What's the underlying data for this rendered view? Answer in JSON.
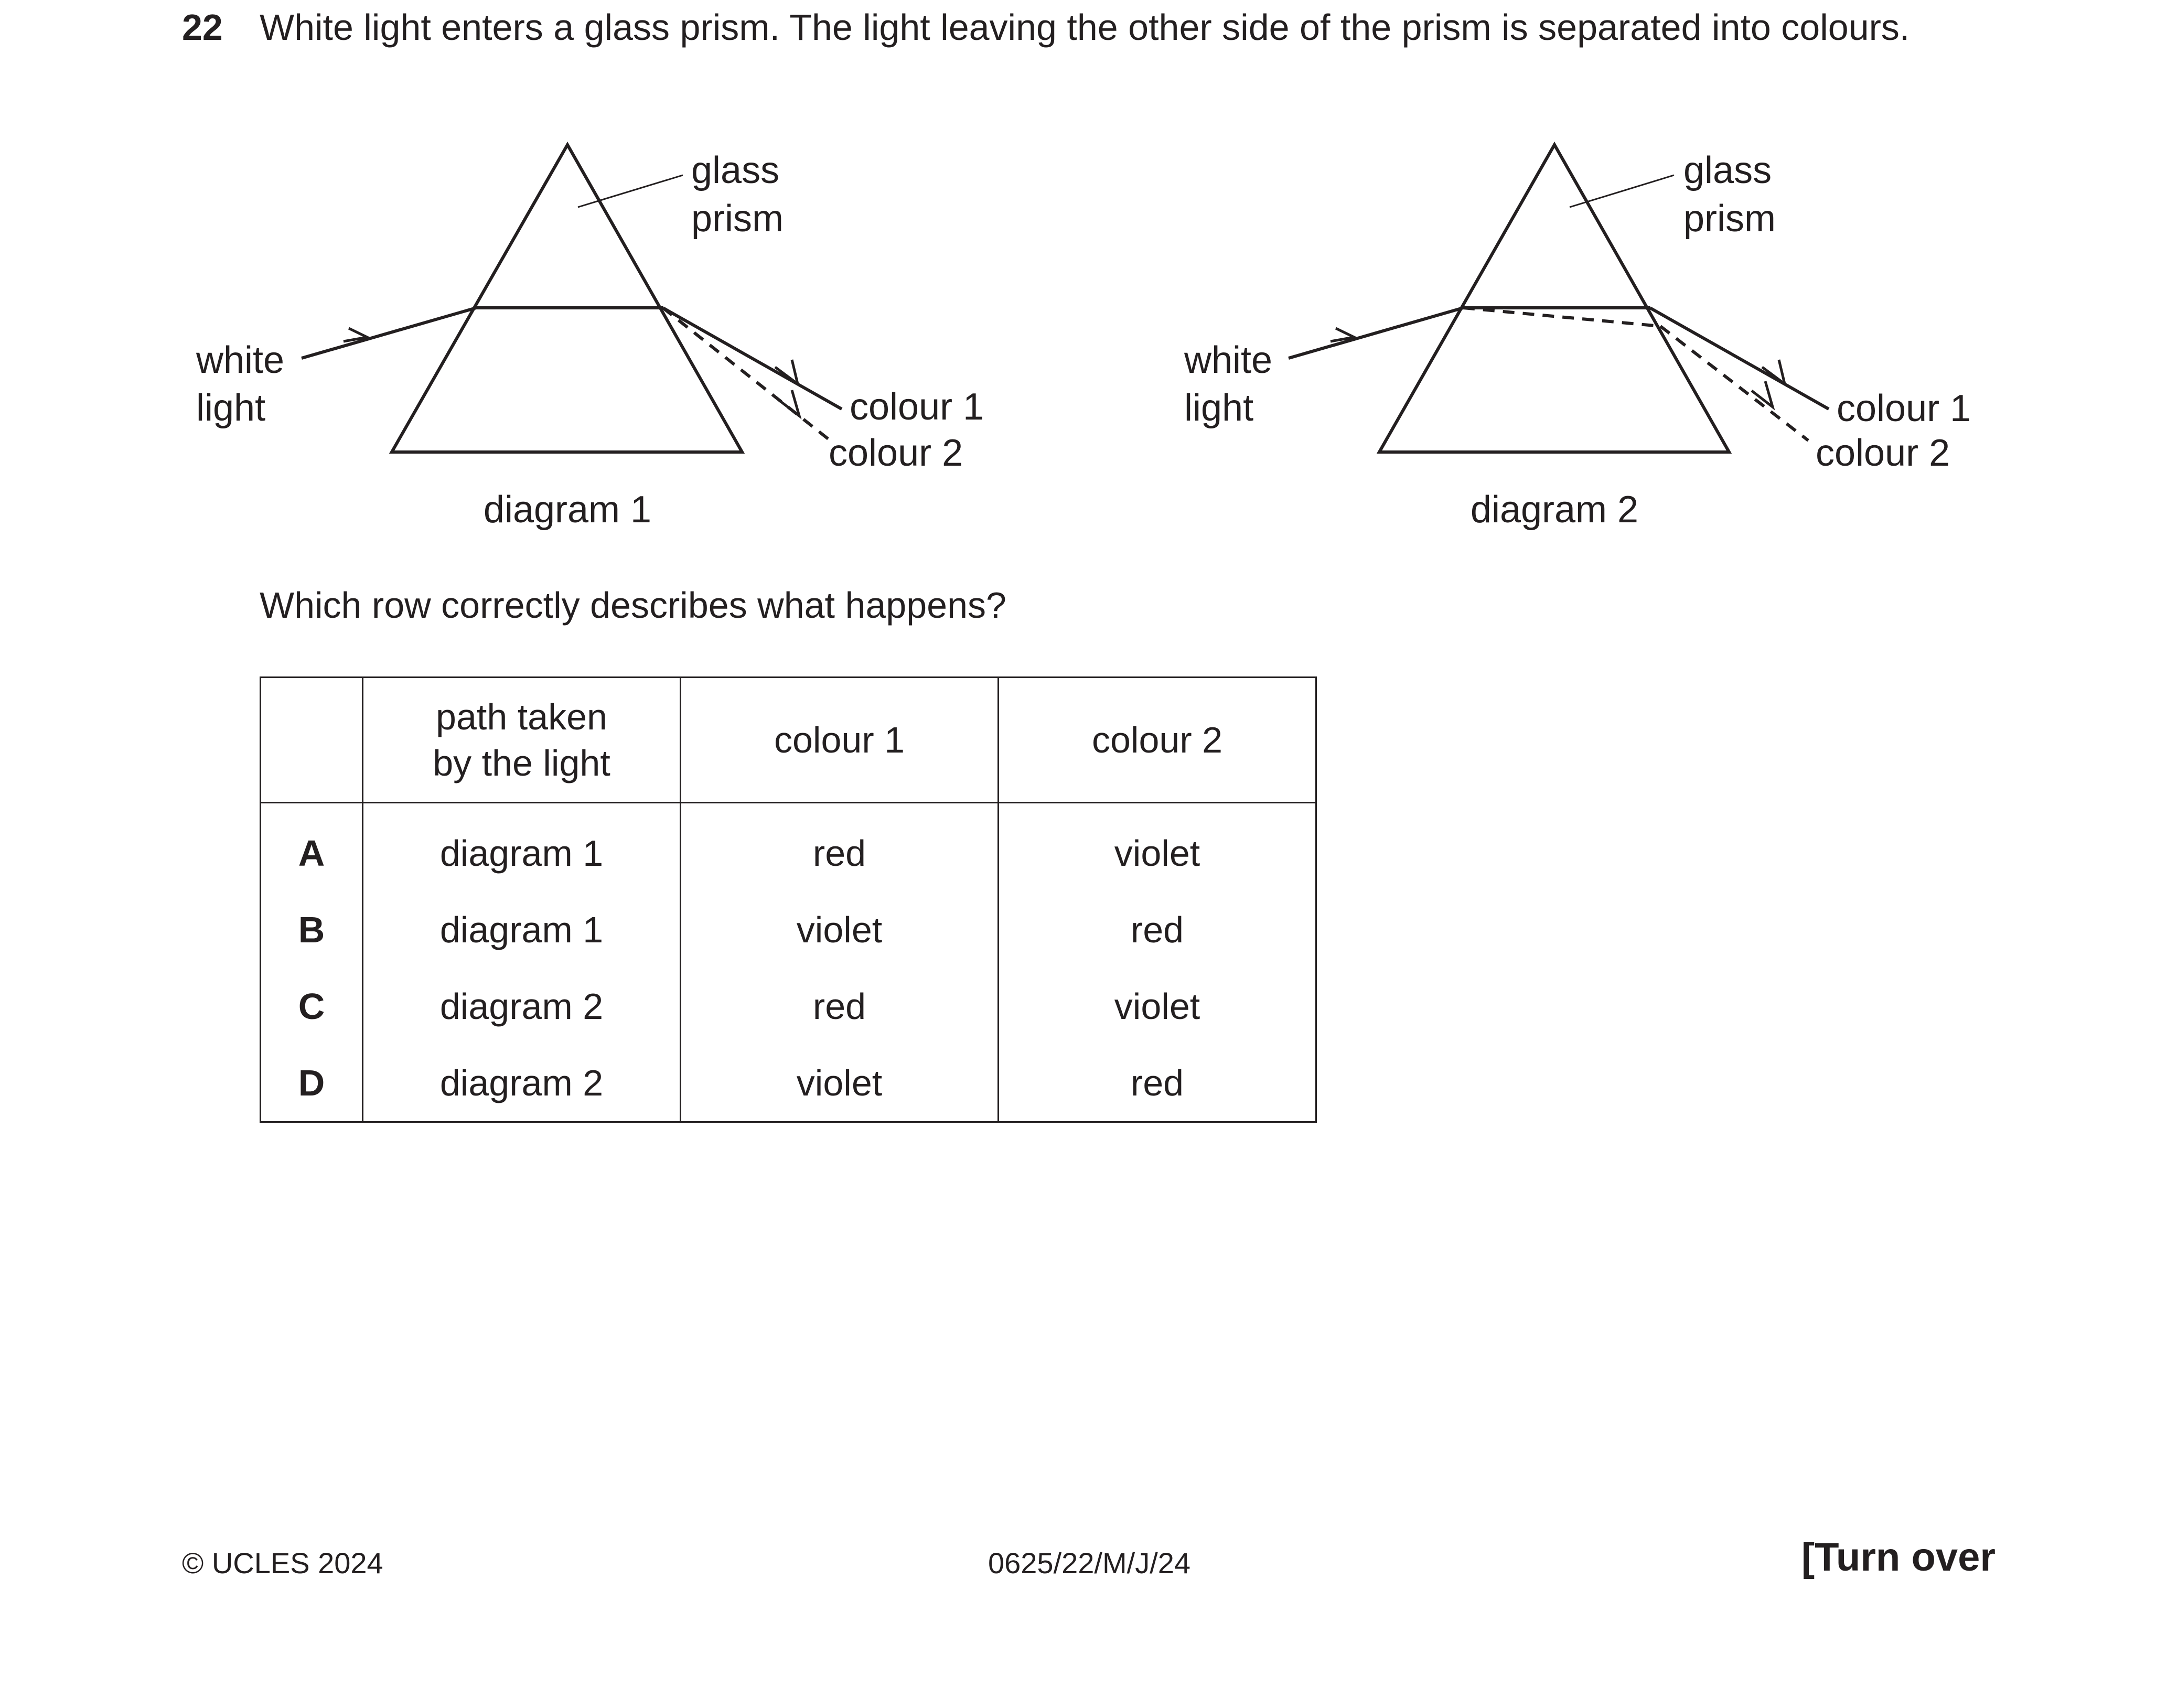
{
  "question": {
    "number": "22",
    "stem": "White light enters a glass prism. The light leaving the other side of the prism is separated into colours.",
    "prompt": "Which row correctly describes what happens?"
  },
  "diagrams": [
    {
      "caption": "diagram 1",
      "prism_label_1": "glass",
      "prism_label_2": "prism",
      "incident_label_1": "white",
      "incident_label_2": "light",
      "ray_label_1": "colour 1",
      "ray_label_2": "colour 2"
    },
    {
      "caption": "diagram 2",
      "prism_label_1": "glass",
      "prism_label_2": "prism",
      "incident_label_1": "white",
      "incident_label_2": "light",
      "ray_label_1": "colour 1",
      "ray_label_2": "colour 2"
    }
  ],
  "table": {
    "headers": [
      "",
      "path taken by the light",
      "colour 1",
      "colour 2"
    ],
    "header_path_line1": "path taken",
    "header_path_line2": "by the light",
    "rows": [
      {
        "key": "A",
        "path": "diagram 1",
        "colour1": "red",
        "colour2": "violet"
      },
      {
        "key": "B",
        "path": "diagram 1",
        "colour1": "violet",
        "colour2": "red"
      },
      {
        "key": "C",
        "path": "diagram 2",
        "colour1": "red",
        "colour2": "violet"
      },
      {
        "key": "D",
        "path": "diagram 2",
        "colour1": "violet",
        "colour2": "red"
      }
    ]
  },
  "footer": {
    "copyright": "© UCLES 2024",
    "code": "0625/22/M/J/24",
    "turn_over": "[Turn over"
  }
}
